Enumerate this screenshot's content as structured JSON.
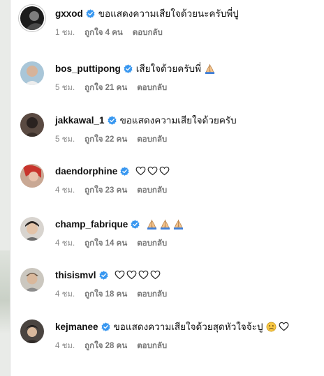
{
  "colors": {
    "verified": "#3897f0",
    "text": "#111111",
    "meta": "#777777",
    "background": "#ffffff"
  },
  "comments": [
    {
      "username": "gxxod",
      "verified": true,
      "text": "ขอแสดงความเสียใจด้วยนะครับพี่ปู",
      "emojis": [],
      "time": "1 ชม.",
      "likes": "ถูกใจ 4 คน",
      "reply": "ตอบกลับ",
      "avatar": "avatar-photo"
    },
    {
      "username": "bos_puttipong",
      "verified": true,
      "text": "เสียใจด้วยครับพี่",
      "emojis": [
        "folded-hands-icon"
      ],
      "time": "5 ชม.",
      "likes": "ถูกใจ 21 คน",
      "reply": "ตอบกลับ",
      "avatar": "avatar-photo"
    },
    {
      "username": "jakkawal_1",
      "verified": true,
      "text": "ขอแสดงความเสียใจด้วยครับ",
      "emojis": [],
      "time": "5 ชม.",
      "likes": "ถูกใจ 22 คน",
      "reply": "ตอบกลับ",
      "avatar": "avatar-photo"
    },
    {
      "username": "daendorphine",
      "verified": true,
      "text": "",
      "emojis": [
        "heart-icon",
        "heart-icon",
        "heart-icon"
      ],
      "time": "4 ชม.",
      "likes": "ถูกใจ 23 คน",
      "reply": "ตอบกลับ",
      "avatar": "avatar-photo"
    },
    {
      "username": "champ_fabrique",
      "verified": true,
      "text": "",
      "emojis": [
        "folded-hands-icon",
        "folded-hands-icon",
        "folded-hands-icon"
      ],
      "time": "4 ชม.",
      "likes": "ถูกใจ 14 คน",
      "reply": "ตอบกลับ",
      "avatar": "avatar-photo"
    },
    {
      "username": "thisismvl",
      "verified": true,
      "text": "",
      "emojis": [
        "heart-icon",
        "heart-icon",
        "heart-icon",
        "heart-icon"
      ],
      "time": "4 ชม.",
      "likes": "ถูกใจ 18 คน",
      "reply": "ตอบกลับ",
      "avatar": "avatar-photo"
    },
    {
      "username": "kejmanee",
      "verified": true,
      "text": "ขอแสดงความเสียใจด้วยสุดหัวใจจ้ะปู",
      "emojis": [
        "frowning-face-icon",
        "heart-icon"
      ],
      "time": "4 ชม.",
      "likes": "ถูกใจ 28 คน",
      "reply": "ตอบกลับ",
      "avatar": "avatar-photo"
    }
  ]
}
